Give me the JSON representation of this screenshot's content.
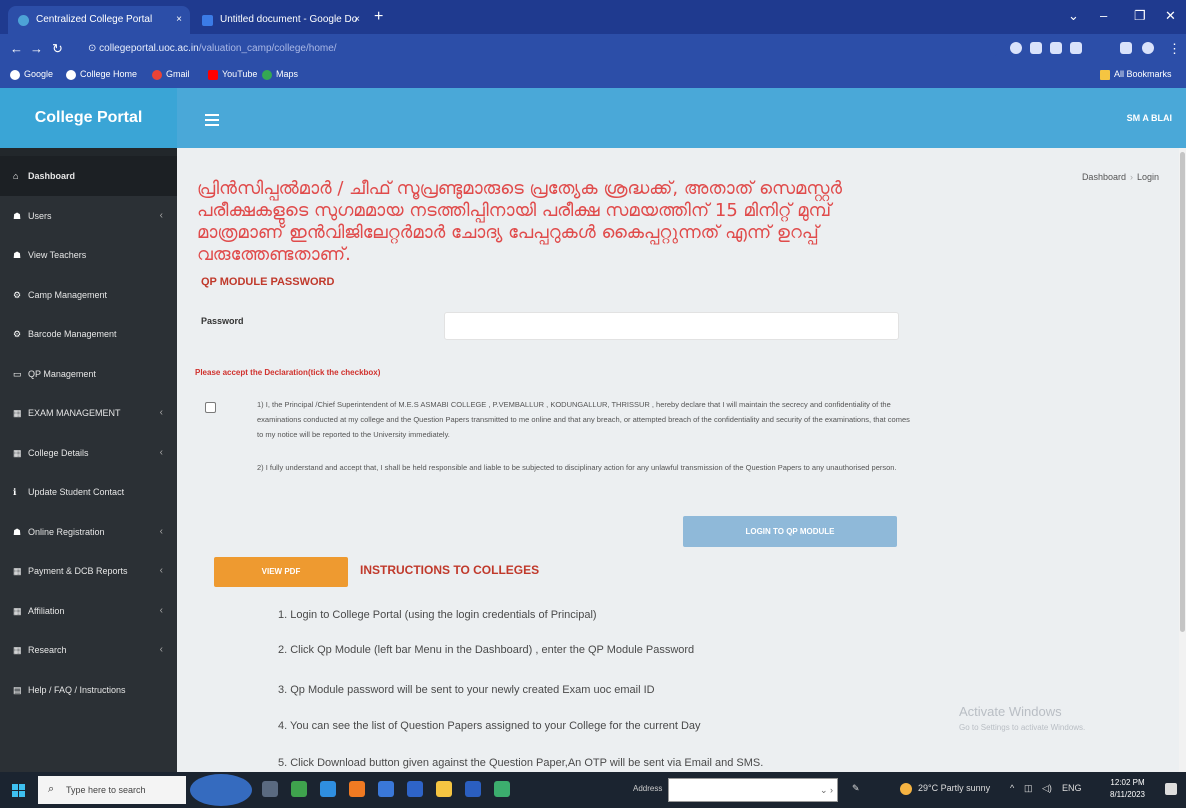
{
  "browser": {
    "tabs": [
      {
        "title": "Centralized College Portal",
        "close": "×",
        "favicon_color": "#4da3d6"
      },
      {
        "title": "Untitled document - Google Do",
        "close": "×",
        "favicon_color": "#3b7be6"
      }
    ],
    "new_tab": "+",
    "url_host": "collegeportal.uoc.ac.in",
    "url_path": "/valuation_camp/college/home/",
    "bookmarks": [
      {
        "label": "Google",
        "icon": "google-icon",
        "color": "#ffffff"
      },
      {
        "label": "College Home",
        "icon": "globe-icon",
        "color": "#ffffff"
      },
      {
        "label": "Gmail",
        "icon": "gmail-icon",
        "color": "#ea4335"
      },
      {
        "label": "YouTube",
        "icon": "youtube-icon",
        "color": "#ff0000"
      },
      {
        "label": "Maps",
        "icon": "maps-icon",
        "color": "#34a853"
      }
    ],
    "all_bookmarks": "All Bookmarks"
  },
  "app": {
    "brand": "College Portal",
    "user": "SM A BLAI",
    "breadcrumb": {
      "home": "Dashboard",
      "current": "Login"
    }
  },
  "sidebar": {
    "items": [
      {
        "label": "Dashboard",
        "icon": "home-icon",
        "glyph": "⌂",
        "active": true,
        "has_submenu": false
      },
      {
        "label": "Users",
        "icon": "users-icon",
        "glyph": "☗",
        "has_submenu": true
      },
      {
        "label": "View Teachers",
        "icon": "teachers-icon",
        "glyph": "☗",
        "has_submenu": false
      },
      {
        "label": "Camp Management",
        "icon": "gear-icon",
        "glyph": "⚙",
        "has_submenu": false
      },
      {
        "label": "Barcode Management",
        "icon": "gear-icon",
        "glyph": "⚙",
        "has_submenu": false
      },
      {
        "label": "QP Management",
        "icon": "monitor-icon",
        "glyph": "▭",
        "has_submenu": false
      },
      {
        "label": "EXAM MANAGEMENT",
        "icon": "grid-icon",
        "glyph": "▦",
        "has_submenu": true
      },
      {
        "label": "College Details",
        "icon": "grid-icon",
        "glyph": "▦",
        "has_submenu": true
      },
      {
        "label": "Update Student Contact",
        "icon": "info-icon",
        "glyph": "ℹ",
        "has_submenu": false
      },
      {
        "label": "Online Registration",
        "icon": "user-icon",
        "glyph": "☗",
        "has_submenu": true
      },
      {
        "label": "Payment & DCB Reports",
        "icon": "grid-icon",
        "glyph": "▦",
        "has_submenu": true
      },
      {
        "label": "Affiliation",
        "icon": "grid-icon",
        "glyph": "▦",
        "has_submenu": true
      },
      {
        "label": "Research",
        "icon": "grid-icon",
        "glyph": "▦",
        "has_submenu": true
      },
      {
        "label": "Help / FAQ / Instructions",
        "icon": "book-icon",
        "glyph": "▤",
        "has_submenu": false
      }
    ],
    "submenu_chevron": "‹"
  },
  "main": {
    "notice": "പ്രിൻസിപ്പൽമാർ / ചീഫ് സൂപ്രണ്ടുമാരുടെ പ്രത്യേക ശ്രദ്ധക്ക്, അതാത് സെമസ്റ്റർ പരീക്ഷകളുടെ സുഗമമായ നടത്തിപ്പിനായി പരീക്ഷ സമയത്തിന് 15 മിനിറ്റ് മുമ്പ് മാത്രമാണ് ഇൻവിജിലേറ്റർമാർ ചോദ്യ പേപ്പറുകൾ കൈപ്പറ്റുന്നത് എന്ന് ഉറപ്പ് വരുത്തേണ്ടതാണ്.",
    "qp_title": "QP MODULE PASSWORD",
    "password_label": "Password",
    "password_value": "",
    "declaration_warning": "Please accept the Declaration(tick the checkbox)",
    "declaration_1": "1) I, the Principal /Chief Superintendent of M.E.S ASMABI COLLEGE , P.VEMBALLUR , KODUNGALLUR, THRISSUR , hereby declare that I will maintain the secrecy and confidentiality of the examinations conducted at my college and the Question Papers transmitted to me online and that any breach, or attempted breach of the confidentiality and security of the examinations, that comes to my notice will be reported to the University immediately.",
    "declaration_2": "2) I fully understand and accept that, I shall be held responsible and liable to be subjected to disciplinary action for any unlawful transmission of the Question Papers to any unauthorised person.",
    "login_button": "LOGIN TO QP MODULE",
    "view_pdf_button": "VIEW PDF",
    "instructions_title": "INSTRUCTIONS TO COLLEGES",
    "instructions": [
      "1. Login to College Portal (using the login credentials of Principal)",
      "2. Click Qp Module (left bar Menu in the Dashboard) , enter the QP Module Password",
      "3. Qp Module password will be sent to your newly created Exam uoc email ID",
      "4. You can see the list of Question Papers assigned to your College for the current Day",
      "5. Click Download button given against the Question Paper,An OTP will be sent via Email and SMS."
    ]
  },
  "watermark": {
    "title": "Activate Windows",
    "subtitle": "Go to Settings to activate Windows."
  },
  "taskbar": {
    "search_placeholder": "Type here to search",
    "address_label": "Address",
    "weather": "29°C Partly sunny",
    "time": "12:02 PM",
    "date": "8/11/2023",
    "app_icons": [
      {
        "icon": "task-view-icon",
        "color": "#5a6a80"
      },
      {
        "icon": "chrome-icon",
        "color": "#3fa34d"
      },
      {
        "icon": "edge-icon",
        "color": "#2f8fe0"
      },
      {
        "icon": "firefox-icon",
        "color": "#f07a22"
      },
      {
        "icon": "store-icon",
        "color": "#3a78d8"
      },
      {
        "icon": "mail-icon",
        "color": "#2e64c8"
      },
      {
        "icon": "explorer-icon",
        "color": "#f5c542"
      },
      {
        "icon": "word-icon",
        "color": "#2b5fc0"
      },
      {
        "icon": "app-icon",
        "color": "#3cae6e"
      }
    ]
  }
}
